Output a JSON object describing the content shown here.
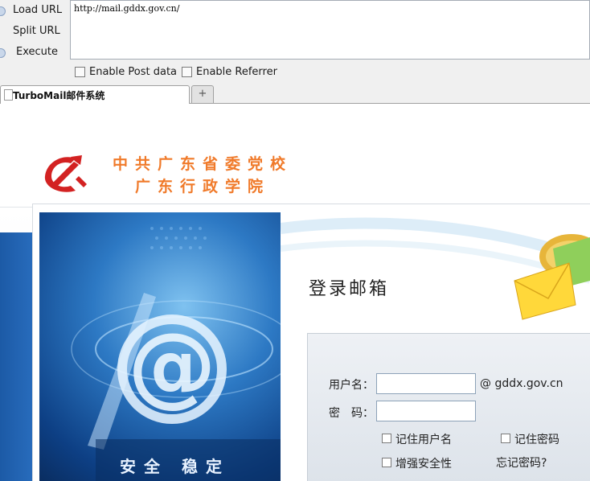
{
  "hackbar": {
    "buttons": [
      {
        "label": "Load URL"
      },
      {
        "label": "Split URL"
      },
      {
        "label": "Execute"
      }
    ],
    "url": "http://mail.gddx.gov.cn/",
    "checkboxes": [
      {
        "label": "Enable Post data",
        "checked": false
      },
      {
        "label": "Enable Referrer",
        "checked": false
      }
    ]
  },
  "tabs": {
    "active_title": "TurboMail邮件系统",
    "new_tab_symbol": "+"
  },
  "page": {
    "logo": {
      "line1": "中共广东省委党校",
      "line2": "广东行政学院"
    },
    "hero_caption": "安全 稳定",
    "login": {
      "heading": "登录邮箱",
      "username_label": "用户名：",
      "password_label": "密　码：",
      "domain_suffix": "@ gddx.gov.cn",
      "username_value": "",
      "password_value": "",
      "remember_user": "记住用户名",
      "remember_password": "记住密码",
      "enhanced_security": "增强安全性",
      "forgot_password": "忘记密码?"
    }
  },
  "colors": {
    "logo_text": "#f07a2a",
    "emblem_red": "#d32222",
    "hero_blue": "#2d79c4"
  }
}
